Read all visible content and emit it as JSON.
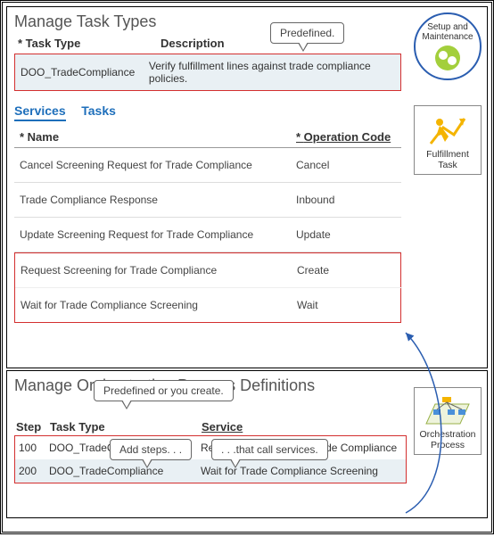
{
  "top": {
    "title": "Manage Task Types",
    "typeHeader": {
      "col1": "Task Type",
      "col2": "Description"
    },
    "typeRow": {
      "name": "DOO_TradeCompliance",
      "desc": "Verify fulfillment lines against trade compliance policies."
    },
    "tabs": {
      "services": "Services",
      "tasks": "Tasks"
    },
    "svcHeader": {
      "name": "Name",
      "op": "Operation Code"
    },
    "services": [
      {
        "name": "Cancel Screening Request for Trade Compliance",
        "op": "Cancel"
      },
      {
        "name": "Trade Compliance Response",
        "op": "Inbound"
      },
      {
        "name": "Update Screening Request for Trade Compliance",
        "op": "Update"
      }
    ],
    "servicesRed": [
      {
        "name": "Request Screening for Trade Compliance",
        "op": "Create"
      },
      {
        "name": "Wait for Trade Compliance Screening",
        "op": "Wait"
      }
    ]
  },
  "bot": {
    "title": "Manage Orchestration Process Definitions",
    "header": {
      "step": "Step",
      "type": "Task Type",
      "service": "Service"
    },
    "rows": [
      {
        "step": "100",
        "type": "DOO_TradeCompliance",
        "service": "Request Screening for Trade Compliance"
      },
      {
        "step": "200",
        "type": "DOO_TradeCompliance",
        "service": "Wait for Trade Compliance Screening"
      }
    ]
  },
  "callouts": {
    "c1": "Predefined.",
    "c2": "Predefined  or you create.",
    "c3": "Add steps. . .",
    "c4": ". . .that call services."
  },
  "icons": {
    "setup": "Setup and Maintenance",
    "ft": "Fulfillment Task",
    "op": "Orchestration Process"
  }
}
